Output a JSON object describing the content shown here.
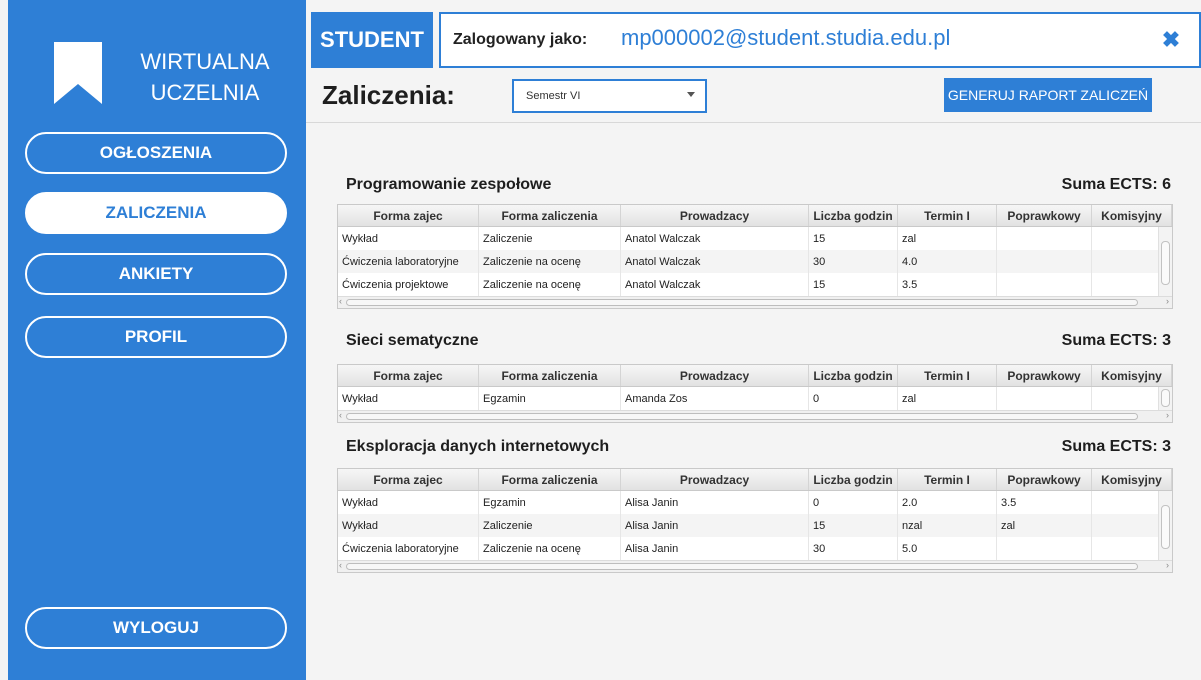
{
  "app": {
    "logo_lines": [
      "WIRTUALNA",
      "UCZELNIA"
    ],
    "colors": {
      "primary": "#2e7fd6",
      "sidebar": "#2e7fd6",
      "background": "#f4f4f4"
    }
  },
  "sidebar": {
    "items": [
      {
        "label": "OGŁOSZENIA",
        "active": false
      },
      {
        "label": "ZALICZENIA",
        "active": true
      },
      {
        "label": "ANKIETY",
        "active": false
      },
      {
        "label": "PROFIL",
        "active": false
      }
    ],
    "logout_label": "WYLOGUJ"
  },
  "header": {
    "role": "STUDENT",
    "logged_as_label": "Zalogowany jako:",
    "email": "mp000002@student.studia.edu.pl",
    "close_icon": "close-icon"
  },
  "main": {
    "title": "Zaliczenia:",
    "semester": {
      "selected": "Semestr VI"
    },
    "report_button": "GENERUJ RAPORT ZALICZEŃ",
    "columns": [
      "Forma zajec",
      "Forma zaliczenia",
      "Prowadzacy",
      "Liczba godzin",
      "Termin I",
      "Poprawkowy",
      "Komisyjny"
    ],
    "courses": [
      {
        "name": "Programowanie zespołowe",
        "ects": "Suma ECTS: 6",
        "rows": [
          [
            "Wykład",
            "Zaliczenie",
            "Anatol Walczak",
            "15",
            "zal",
            "",
            ""
          ],
          [
            "Ćwiczenia laboratoryjne",
            "Zaliczenie na ocenę",
            "Anatol Walczak",
            "30",
            "4.0",
            "",
            ""
          ],
          [
            "Ćwiczenia projektowe",
            "Zaliczenie na ocenę",
            "Anatol Walczak",
            "15",
            "3.5",
            "",
            ""
          ]
        ]
      },
      {
        "name": "Sieci sematyczne",
        "ects": "Suma ECTS: 3",
        "rows": [
          [
            "Wykład",
            "Egzamin",
            "Amanda Zos",
            "0",
            "zal",
            "",
            ""
          ]
        ]
      },
      {
        "name": "Eksploracja danych internetowych",
        "ects": "Suma ECTS: 3",
        "rows": [
          [
            "Wykład",
            "Egzamin",
            "Alisa Janin",
            "0",
            "2.0",
            "3.5",
            ""
          ],
          [
            "Wykład",
            "Zaliczenie",
            "Alisa Janin",
            "15",
            "nzal",
            "zal",
            ""
          ],
          [
            "Ćwiczenia laboratoryjne",
            "Zaliczenie na ocenę",
            "Alisa Janin",
            "30",
            "5.0",
            "",
            ""
          ]
        ]
      }
    ]
  }
}
